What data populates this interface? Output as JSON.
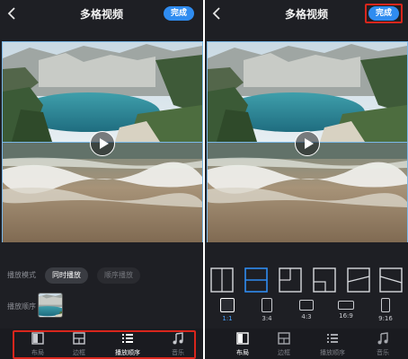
{
  "left": {
    "header": {
      "title": "多格视频",
      "done_label": "完成"
    },
    "play_mode": {
      "label": "播放模式",
      "options": [
        "同时播放",
        "顺序播放"
      ],
      "selected": "同时播放"
    },
    "play_order": {
      "label": "播放顺序"
    },
    "tabs": [
      {
        "label": "布局",
        "icon": "layout-icon"
      },
      {
        "label": "边框",
        "icon": "border-icon"
      },
      {
        "label": "播放顺序",
        "icon": "list-icon"
      },
      {
        "label": "音乐",
        "icon": "music-note-icon"
      }
    ],
    "active_tab": "播放顺序"
  },
  "right": {
    "header": {
      "title": "多格视频",
      "done_label": "完成"
    },
    "layout_options": [
      "single",
      "split-horizontal",
      "three-grid",
      "corner",
      "diagonal",
      "diagonal-split"
    ],
    "selected_layout": "split-horizontal",
    "ratios": [
      "1:1",
      "3:4",
      "4:3",
      "16:9",
      "9:16"
    ],
    "selected_ratio": "1:1",
    "tabs": [
      {
        "label": "布局",
        "icon": "layout-icon"
      },
      {
        "label": "边框",
        "icon": "border-icon"
      },
      {
        "label": "播放顺序",
        "icon": "list-icon"
      },
      {
        "label": "音乐",
        "icon": "music-note-icon"
      }
    ],
    "active_tab": "布局"
  },
  "colors": {
    "accent": "#2f8cf0",
    "highlight": "#d9261c",
    "background": "#1e1f24",
    "selected_border": "#7ab8e8"
  }
}
